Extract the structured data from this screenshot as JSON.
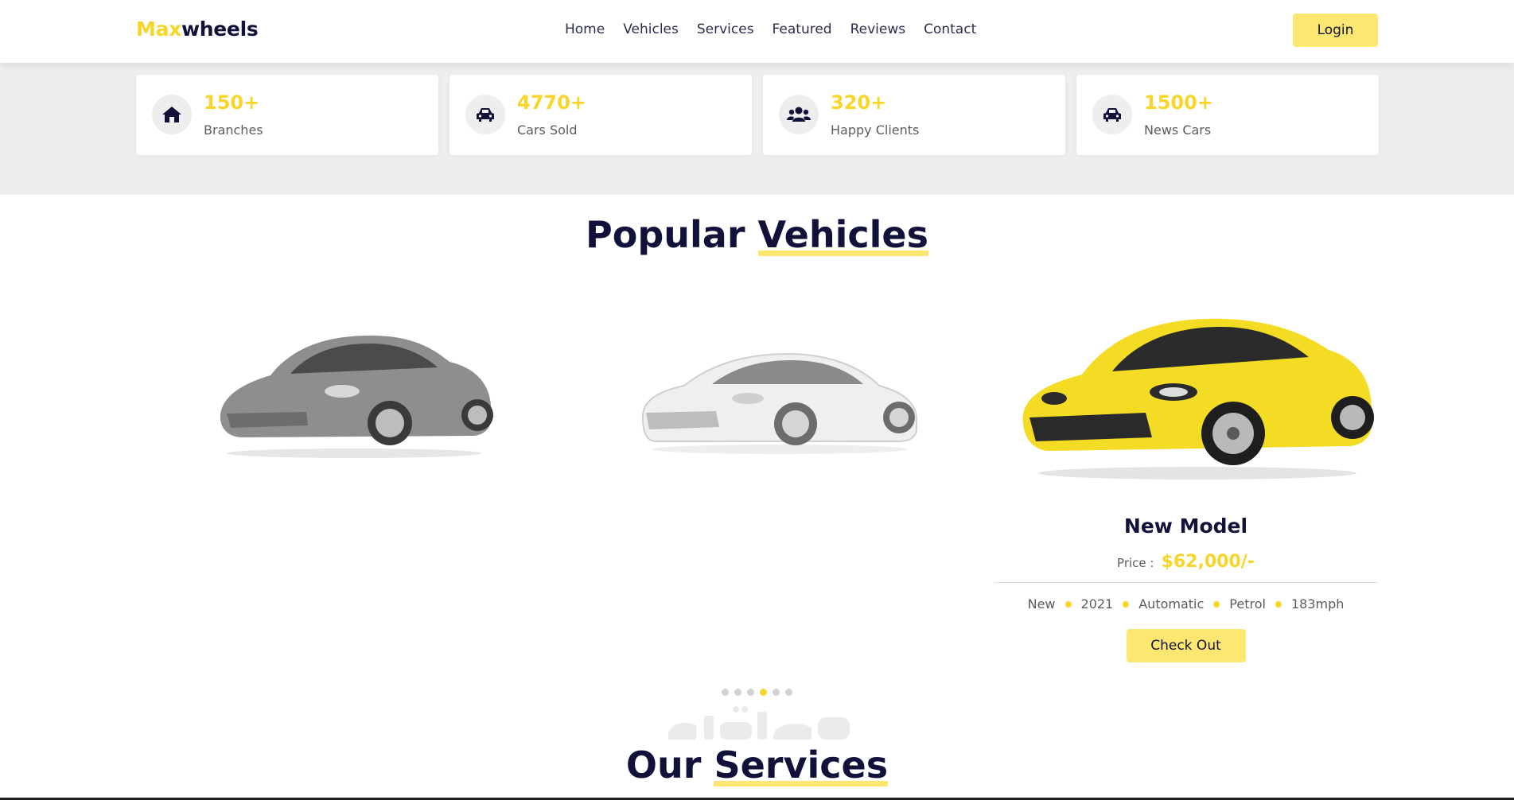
{
  "header": {
    "logo_part1": "Max",
    "logo_part2": "wheels",
    "nav": [
      "Home",
      "Vehicles",
      "Services",
      "Featured",
      "Reviews",
      "Contact"
    ],
    "login_label": "Login"
  },
  "stats": [
    {
      "number": "150+",
      "label": "Branches",
      "icon": "home-icon"
    },
    {
      "number": "4770+",
      "label": "Cars Sold",
      "icon": "car-icon"
    },
    {
      "number": "320+",
      "label": "Happy Clients",
      "icon": "users-icon"
    },
    {
      "number": "1500+",
      "label": "News Cars",
      "icon": "car-icon"
    }
  ],
  "vehicles_section": {
    "title_part1": "Popular",
    "title_part2": "Vehicles",
    "active_vehicle": {
      "name": "New Model",
      "price_label": "Price :",
      "price": "$62,000/-",
      "specs": [
        "New",
        "2021",
        "Automatic",
        "Petrol",
        "183mph"
      ],
      "button_label": "Check Out"
    },
    "slides_count": 6,
    "active_slide": 4
  },
  "services_section": {
    "title_part1": "Our",
    "title_part2": "Services"
  },
  "colors": {
    "accent": "#f8d528",
    "button": "#fde771",
    "dark": "#10123a",
    "band": "#eeeeee"
  }
}
